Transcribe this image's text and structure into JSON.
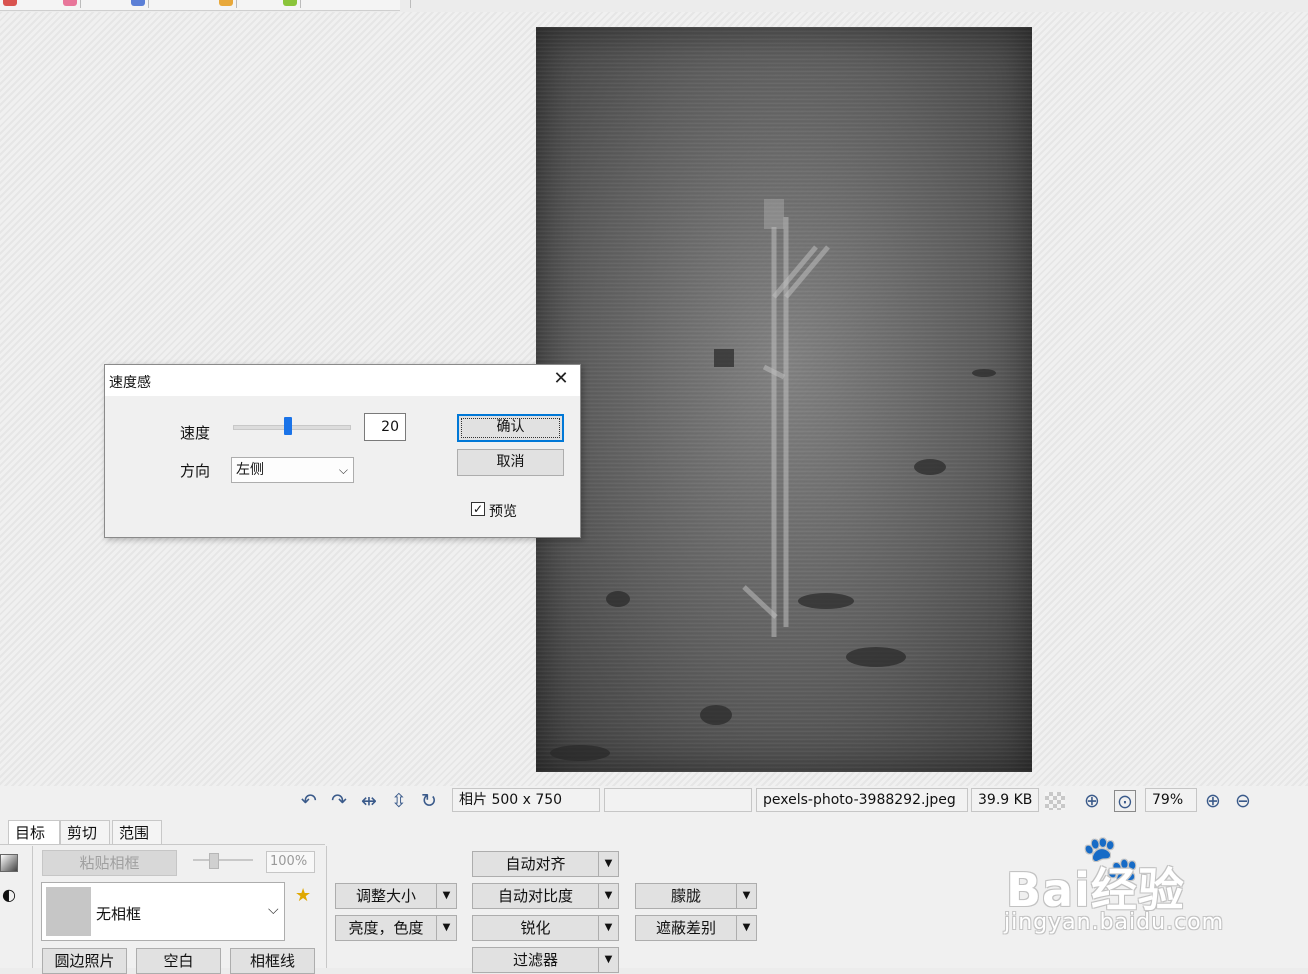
{
  "dialog": {
    "title": "速度感",
    "speed_label": "速度",
    "speed_value": "20",
    "direction_label": "方向",
    "direction_value": "左侧",
    "ok_label": "确认",
    "cancel_label": "取消",
    "preview_label": "预览",
    "preview_checked": true
  },
  "status_bar": {
    "photo_size": "相片 500 x 750",
    "empty_field": "",
    "filename": "pexels-photo-3988292.jpeg",
    "filesize": "39.9 KB",
    "zoom": "79%",
    "icons": [
      "undo-icon",
      "redo-icon",
      "flip-horizontal-icon",
      "flip-vertical-icon",
      "rotate-icon",
      "zoom-actual-icon",
      "zoom-fit-icon",
      "zoom-in-icon",
      "zoom-out-icon"
    ]
  },
  "bottom_panel": {
    "tabs": [
      "目标",
      "剪切",
      "范围"
    ],
    "paste_frame_label": "粘贴相框",
    "opacity_value": "100%",
    "frame_value": "无相框",
    "round_photo_label": "圆边照片",
    "blank_label": "空白",
    "frame_line_label": "相框线",
    "resize_label": "调整大小",
    "brightness_label": "亮度，色度",
    "auto_align_label": "自动对齐",
    "auto_contrast_label": "自动对比度",
    "sharpen_label": "锐化",
    "filter_label": "过滤器",
    "blur_label": "朦胧",
    "mask_label": "遮蔽差别"
  },
  "watermark": {
    "text": "Bai经验",
    "sub": "jingyan.baidu.com"
  }
}
